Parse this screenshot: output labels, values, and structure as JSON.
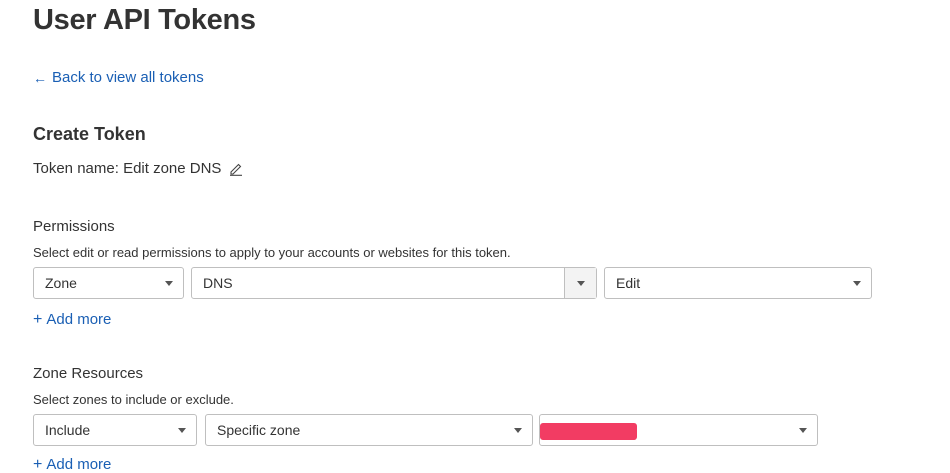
{
  "page": {
    "title": "User API Tokens"
  },
  "back_link": {
    "label": "Back to view all tokens",
    "icon": "arrow-left-icon"
  },
  "create": {
    "heading": "Create Token",
    "token_name_label": "Token name:",
    "token_name_value": "Edit zone DNS",
    "edit_icon": "pencil-icon"
  },
  "permissions": {
    "heading": "Permissions",
    "description": "Select edit or read permissions to apply to your accounts or websites for this token.",
    "selects": {
      "scope": "Zone",
      "resource": "DNS",
      "access": "Edit"
    },
    "add_more": "Add more"
  },
  "zone_resources": {
    "heading": "Zone Resources",
    "description": "Select zones to include or exclude.",
    "selects": {
      "mode": "Include",
      "target": "Specific zone",
      "zone": ""
    },
    "redaction_color": "#f23c63",
    "add_more": "Add more"
  },
  "colors": {
    "link": "#1a5fb4",
    "border": "#bfbfbf",
    "text": "#333333"
  }
}
